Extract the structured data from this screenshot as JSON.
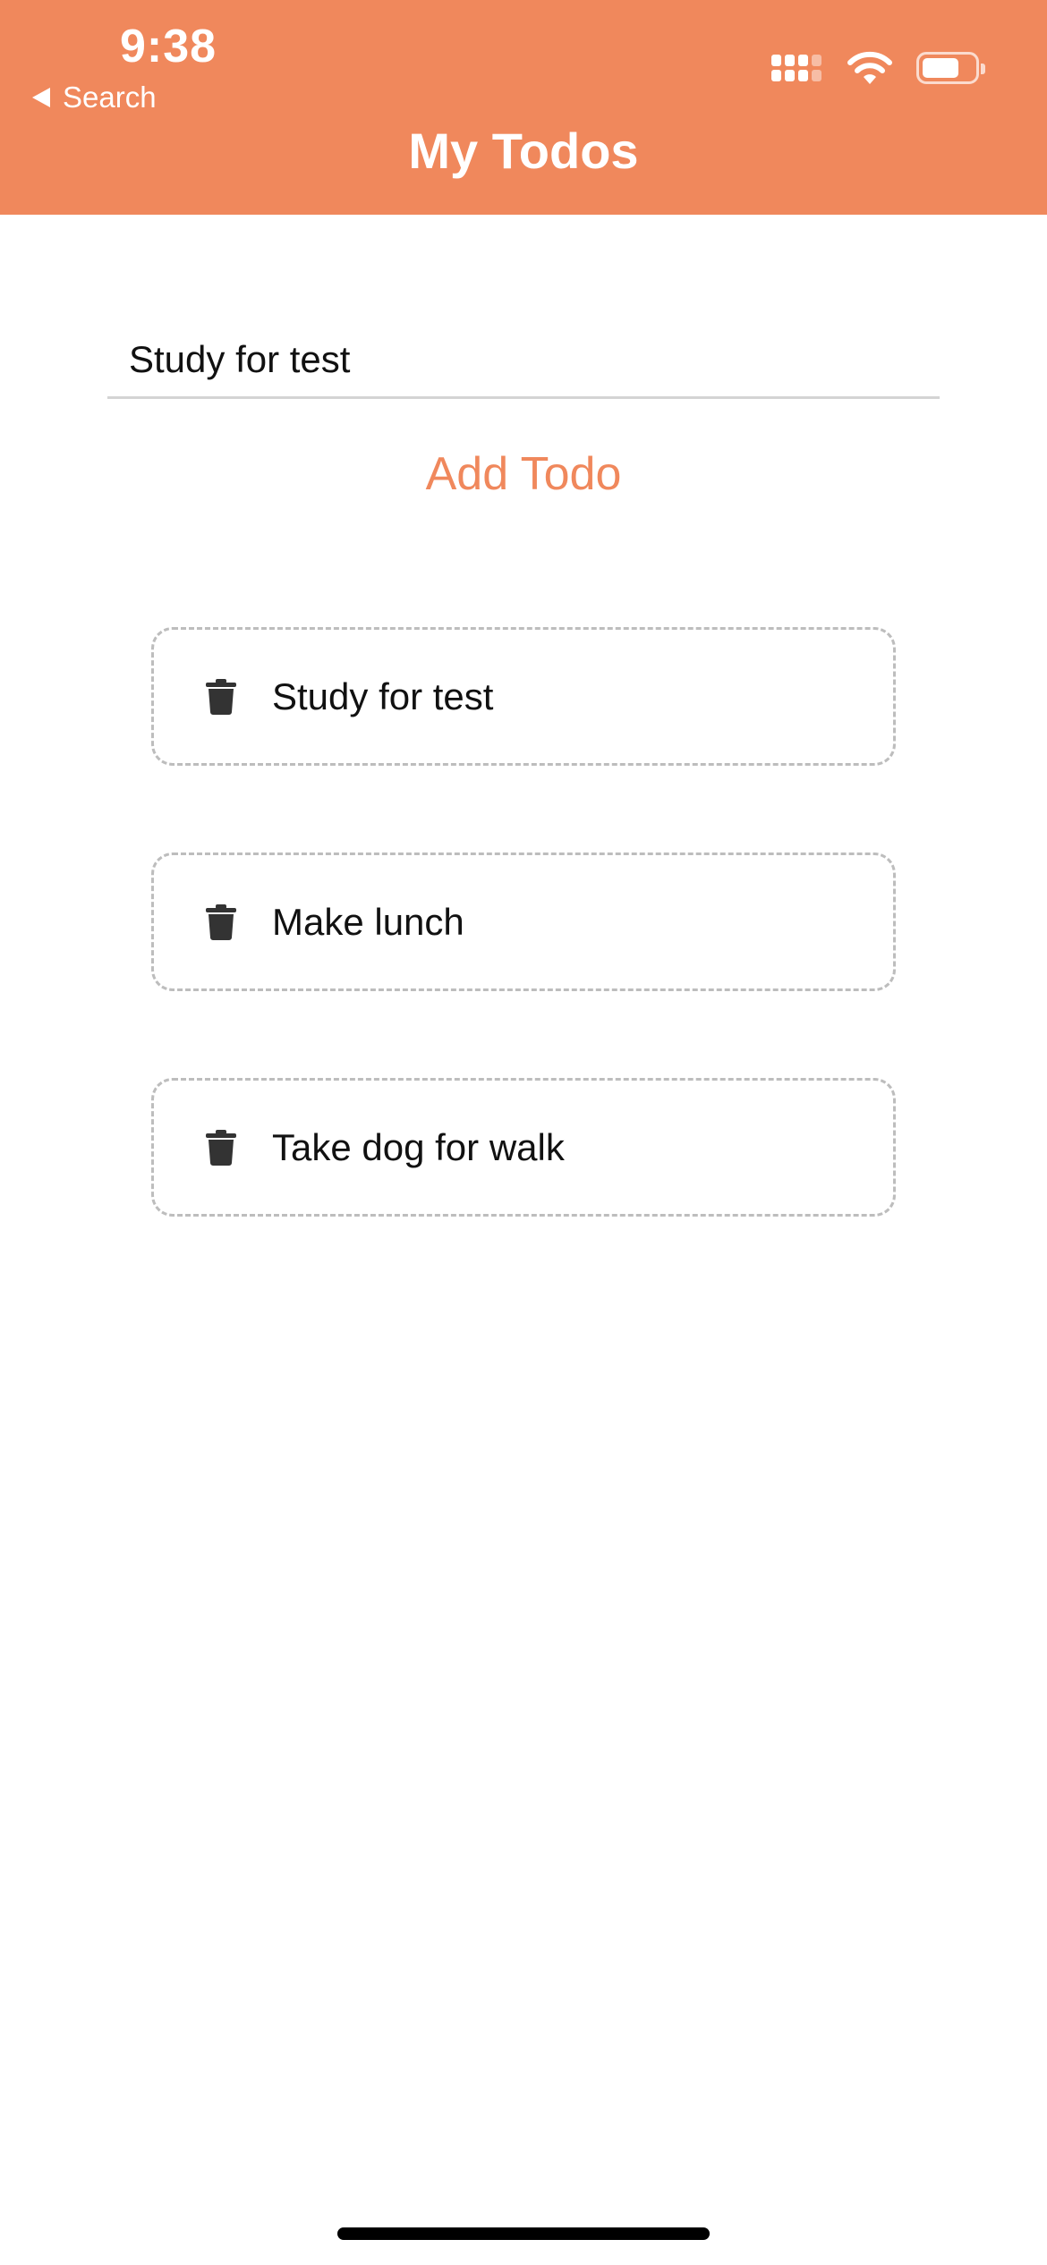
{
  "status_bar": {
    "time": "9:38",
    "back_label": "Search"
  },
  "header": {
    "title": "My Todos",
    "color": "#f0885c"
  },
  "form": {
    "input_value": "Study for test",
    "add_label": "Add Todo"
  },
  "todos": [
    {
      "text": "Study for test",
      "icon": "trash-icon"
    },
    {
      "text": "Make lunch",
      "icon": "trash-icon"
    },
    {
      "text": "Take dog for walk",
      "icon": "trash-icon"
    }
  ]
}
